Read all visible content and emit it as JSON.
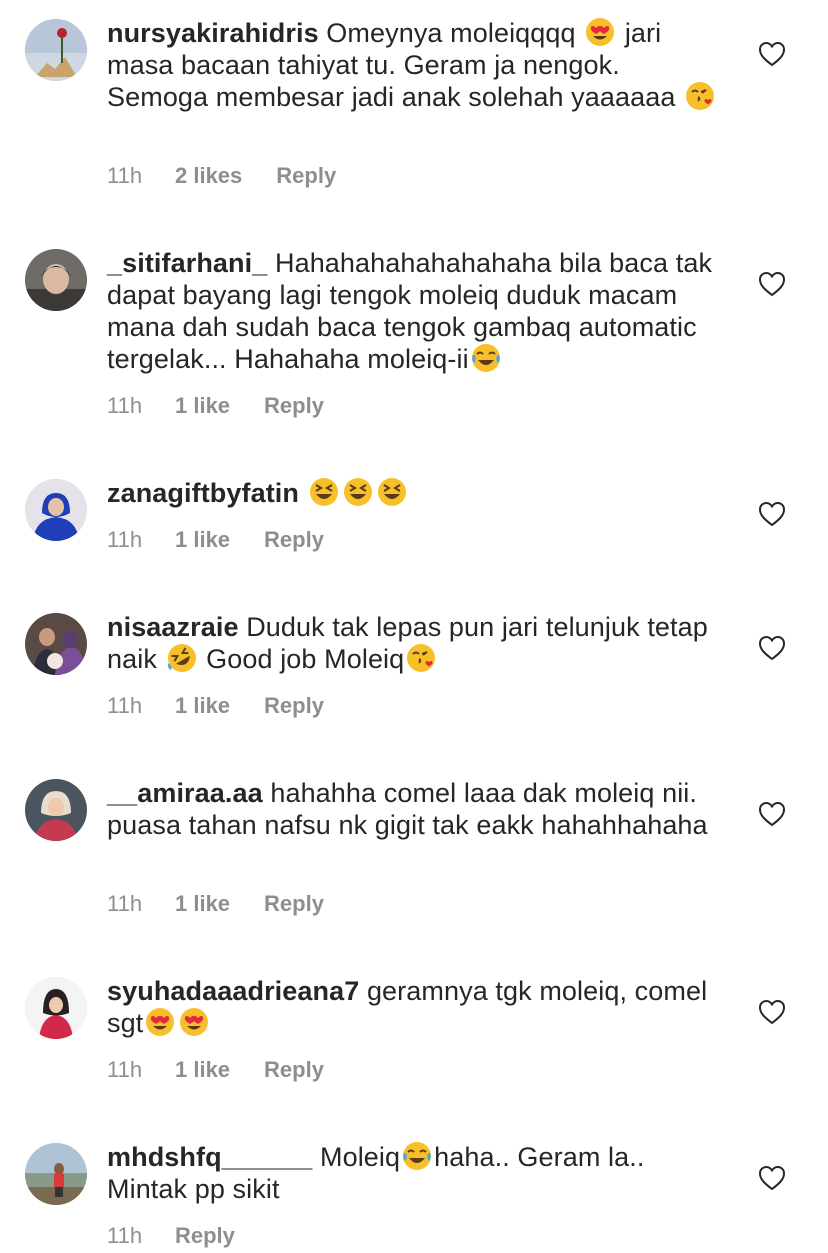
{
  "comments": [
    {
      "username": "nursyakirahidris",
      "text_1": " Omeynya moleiqqqq ",
      "text_2": " jari masa bacaan tahiyat tu. Geram ja nengok. Semoga membesar jadi anak solehah yaaaaaa ",
      "time": "11h",
      "likes": "2 likes",
      "reply": "Reply"
    },
    {
      "username": "_sitifarhani_",
      "text_1": " Hahahahahahahahaha bila baca tak dapat bayang lagi tengok moleiq duduk macam mana dah sudah baca tengok gambaq automatic tergelak... Hahahaha moleiq-ii",
      "time": "11h",
      "likes": "1 like",
      "reply": "Reply"
    },
    {
      "username": "zanagiftbyfatin",
      "text_1": " ",
      "time": "11h",
      "likes": "1 like",
      "reply": "Reply"
    },
    {
      "username": "nisaazraie",
      "text_1": " Duduk tak lepas pun jari telunjuk tetap naik ",
      "text_2": " Good job Moleiq",
      "time": "11h",
      "likes": "1 like",
      "reply": "Reply"
    },
    {
      "username": "__amiraa.aa",
      "text_1": " hahahha comel laaa dak moleiq nii. puasa tahan nafsu nk gigit tak eakk hahahhahaha",
      "time": "11h",
      "likes": "1 like",
      "reply": "Reply"
    },
    {
      "username": "syuhadaaadrieana7",
      "text_1": " geramnya tgk moleiq, comel sgt",
      "time": "11h",
      "likes": "1 like",
      "reply": "Reply"
    },
    {
      "username": "mhdshfq______",
      "text_1": " Moleiq",
      "text_2": "haha.. Geram la.. Mintak pp sikit",
      "time": "11h",
      "reply": "Reply"
    }
  ],
  "icons": {
    "heart": "heart-outline-icon",
    "emoji_heart_eyes": "heart-eyes-emoji",
    "emoji_kiss": "face-blowing-kiss-emoji",
    "emoji_joy": "tears-of-joy-emoji",
    "emoji_grin": "grinning-squinting-emoji",
    "emoji_rofl": "rolling-on-floor-laughing-emoji"
  },
  "colors": {
    "text": "#262626",
    "meta": "#8e8e8e",
    "emoji_yellow": "#f7c02a",
    "emoji_heart": "#e8283b"
  }
}
